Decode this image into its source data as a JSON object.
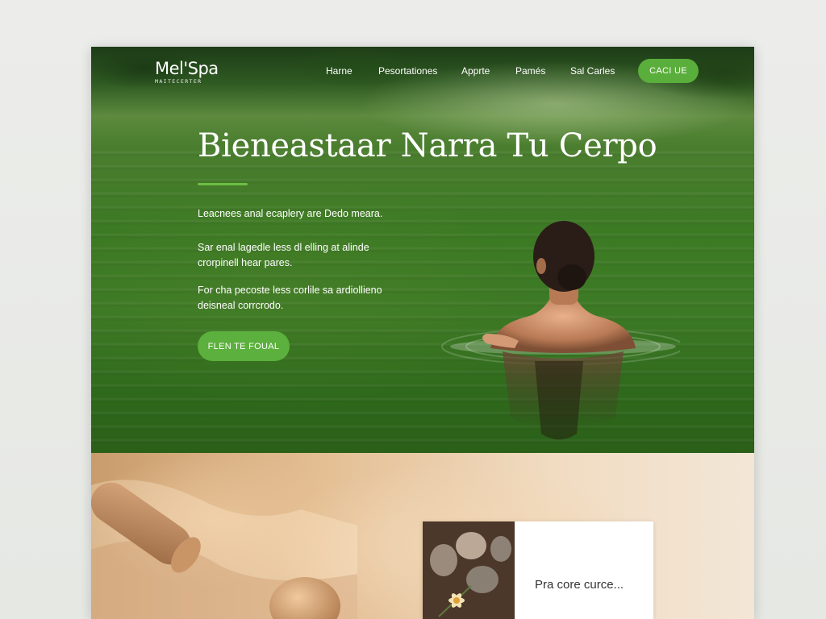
{
  "header": {
    "logo_title": "Mel'Spa",
    "logo_subtitle": "MAITECERTER",
    "nav": [
      {
        "label": "Harne"
      },
      {
        "label": "Pesortationes"
      },
      {
        "label": "Apprte"
      },
      {
        "label": "Pamés"
      },
      {
        "label": "Sal Carles"
      }
    ],
    "cta_label": "CACI UE"
  },
  "hero": {
    "title": "Bieneastaar Narra Tu Cerpo",
    "lead": "Leacnees anal ecaplery are Dedo meara.",
    "paragraph1_line1": "Sar enal lagedle less dl elling at alinde",
    "paragraph1_line2": "crorpinell hear pares.",
    "paragraph2_line1": "For cha pecoste less corlile sa ardiollieno",
    "paragraph2_line2": "deisneal corrcrodo.",
    "cta_label": "FLEN TE FOUAL"
  },
  "card": {
    "text": "Pra core curce..."
  },
  "colors": {
    "accent_green": "#5aae3b",
    "hero_green": "#3c7a24",
    "sand": "#e4bf94"
  }
}
